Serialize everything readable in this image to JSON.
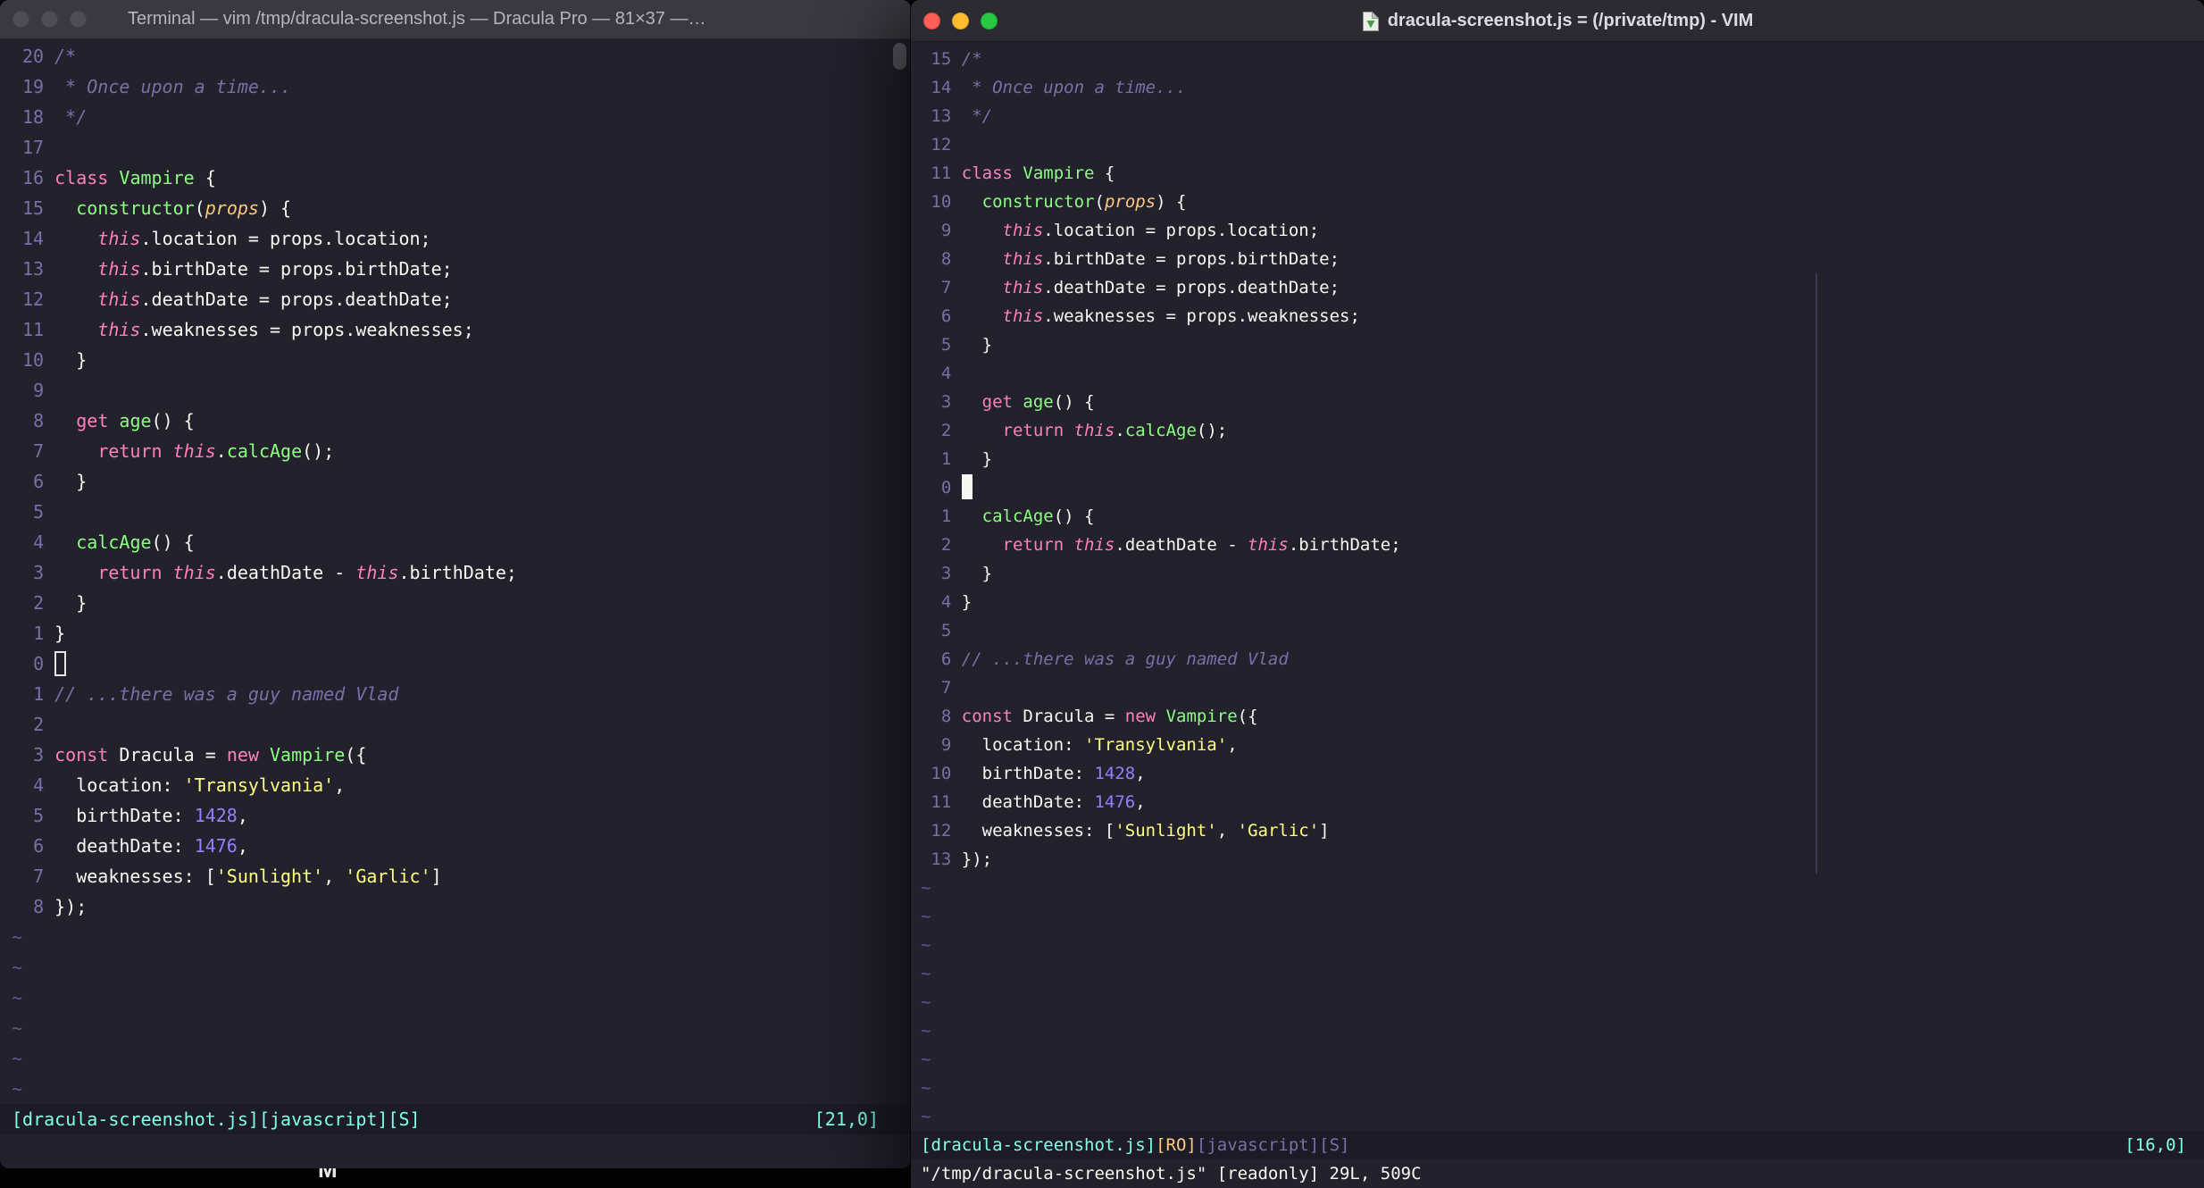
{
  "colors": {
    "background": "#22212c",
    "foreground": "#f8f8f2",
    "comment": "#7970a9",
    "pink": "#ff80bf",
    "green": "#8aff80",
    "yellow": "#ffff80",
    "purple": "#9580ff",
    "cyan": "#80ffea",
    "orange": "#ffca80",
    "line_number": "#7970a9",
    "statusbar_bg": "#1c1b26",
    "traffic_red": "#ff5f57",
    "traffic_yellow": "#febc2e",
    "traffic_green": "#28c840"
  },
  "file": {
    "tilde": "~",
    "lines": [
      [
        {
          "t": "/*",
          "c": "comment"
        }
      ],
      [
        {
          "t": " * Once upon a time...",
          "c": "comment"
        }
      ],
      [
        {
          "t": " */",
          "c": "comment"
        }
      ],
      [],
      [
        {
          "t": "class",
          "c": "pink"
        },
        {
          "t": " ",
          "c": "fg"
        },
        {
          "t": "Vampire",
          "c": "green"
        },
        {
          "t": " {",
          "c": "fg"
        }
      ],
      [
        {
          "t": "  ",
          "c": "fg"
        },
        {
          "t": "constructor",
          "c": "green"
        },
        {
          "t": "(",
          "c": "fg"
        },
        {
          "t": "props",
          "c": "orange-i"
        },
        {
          "t": ") {",
          "c": "fg"
        }
      ],
      [
        {
          "t": "    ",
          "c": "fg"
        },
        {
          "t": "this",
          "c": "pink-i"
        },
        {
          "t": ".location = props.location;",
          "c": "fg"
        }
      ],
      [
        {
          "t": "    ",
          "c": "fg"
        },
        {
          "t": "this",
          "c": "pink-i"
        },
        {
          "t": ".birthDate = props.birthDate;",
          "c": "fg"
        }
      ],
      [
        {
          "t": "    ",
          "c": "fg"
        },
        {
          "t": "this",
          "c": "pink-i"
        },
        {
          "t": ".deathDate = props.deathDate;",
          "c": "fg"
        }
      ],
      [
        {
          "t": "    ",
          "c": "fg"
        },
        {
          "t": "this",
          "c": "pink-i"
        },
        {
          "t": ".weaknesses = props.weaknesses;",
          "c": "fg"
        }
      ],
      [
        {
          "t": "  }",
          "c": "fg"
        }
      ],
      [],
      [
        {
          "t": "  ",
          "c": "fg"
        },
        {
          "t": "get",
          "c": "pink"
        },
        {
          "t": " ",
          "c": "fg"
        },
        {
          "t": "age",
          "c": "green"
        },
        {
          "t": "() {",
          "c": "fg"
        }
      ],
      [
        {
          "t": "    ",
          "c": "fg"
        },
        {
          "t": "return",
          "c": "pink"
        },
        {
          "t": " ",
          "c": "fg"
        },
        {
          "t": "this",
          "c": "pink-i"
        },
        {
          "t": ".",
          "c": "fg"
        },
        {
          "t": "calcAge",
          "c": "green"
        },
        {
          "t": "();",
          "c": "fg"
        }
      ],
      [
        {
          "t": "  }",
          "c": "fg"
        }
      ],
      [],
      [
        {
          "t": "  ",
          "c": "fg"
        },
        {
          "t": "calcAge",
          "c": "green"
        },
        {
          "t": "() {",
          "c": "fg"
        }
      ],
      [
        {
          "t": "    ",
          "c": "fg"
        },
        {
          "t": "return",
          "c": "pink"
        },
        {
          "t": " ",
          "c": "fg"
        },
        {
          "t": "this",
          "c": "pink-i"
        },
        {
          "t": ".deathDate - ",
          "c": "fg"
        },
        {
          "t": "this",
          "c": "pink-i"
        },
        {
          "t": ".birthDate;",
          "c": "fg"
        }
      ],
      [
        {
          "t": "  }",
          "c": "fg"
        }
      ],
      [
        {
          "t": "}",
          "c": "fg"
        }
      ],
      [],
      [
        {
          "t": "// ...there was a guy named Vlad",
          "c": "comment"
        }
      ],
      [],
      [
        {
          "t": "const",
          "c": "pink"
        },
        {
          "t": " Dracula = ",
          "c": "fg"
        },
        {
          "t": "new",
          "c": "pink"
        },
        {
          "t": " ",
          "c": "fg"
        },
        {
          "t": "Vampire",
          "c": "green"
        },
        {
          "t": "({",
          "c": "fg"
        }
      ],
      [
        {
          "t": "  location: ",
          "c": "fg"
        },
        {
          "t": "'Transylvania'",
          "c": "yellow"
        },
        {
          "t": ",",
          "c": "fg"
        }
      ],
      [
        {
          "t": "  birthDate: ",
          "c": "fg"
        },
        {
          "t": "1428",
          "c": "purple"
        },
        {
          "t": ",",
          "c": "fg"
        }
      ],
      [
        {
          "t": "  deathDate: ",
          "c": "fg"
        },
        {
          "t": "1476",
          "c": "purple"
        },
        {
          "t": ",",
          "c": "fg"
        }
      ],
      [
        {
          "t": "  weaknesses: [",
          "c": "fg"
        },
        {
          "t": "'Sunlight'",
          "c": "yellow"
        },
        {
          "t": ", ",
          "c": "fg"
        },
        {
          "t": "'Garlic'",
          "c": "yellow"
        },
        {
          "t": "]",
          "c": "fg"
        }
      ],
      [
        {
          "t": "});",
          "c": "fg"
        }
      ]
    ]
  },
  "left_window": {
    "title": "Terminal — vim /tmp/dracula-screenshot.js — Dracula Pro — 81×37 —…",
    "rel_numbers": [
      "20",
      "19",
      "18",
      "17",
      "16",
      "15",
      "14",
      "13",
      "12",
      "11",
      "10",
      "9",
      "8",
      "7",
      "6",
      "5",
      "4",
      "3",
      "2",
      "1",
      "0",
      "1",
      "2",
      "3",
      "4",
      "5",
      "6",
      "7",
      "8"
    ],
    "cursor_row": 20,
    "cursor_style": "hollow",
    "tilde_rows": 6,
    "status_left": "[dracula-screenshot.js][javascript][S]",
    "status_right": "[21,0]",
    "command_line": ""
  },
  "right_window": {
    "title": "dracula-screenshot.js = (/private/tmp) - VIM",
    "rel_numbers": [
      "15",
      "14",
      "13",
      "12",
      "11",
      "10",
      "9",
      "8",
      "7",
      "6",
      "5",
      "4",
      "3",
      "2",
      "1",
      "0",
      "1",
      "2",
      "3",
      "4",
      "5",
      "6",
      "7",
      "8",
      "9",
      "10",
      "11",
      "12",
      "13"
    ],
    "cursor_row": 15,
    "cursor_style": "solid",
    "tilde_rows": 9,
    "status_segments": [
      {
        "t": "[dracula-screenshot.js]",
        "c": "cyan"
      },
      {
        "t": "[RO]",
        "c": "orange"
      },
      {
        "t": "[javascript][S]",
        "c": "dim"
      }
    ],
    "status_right": "[16,0]",
    "command_line": "\"/tmp/dracula-screenshot.js\" [readonly] 29L, 509C"
  },
  "desktop": {
    "fragment": "M"
  }
}
